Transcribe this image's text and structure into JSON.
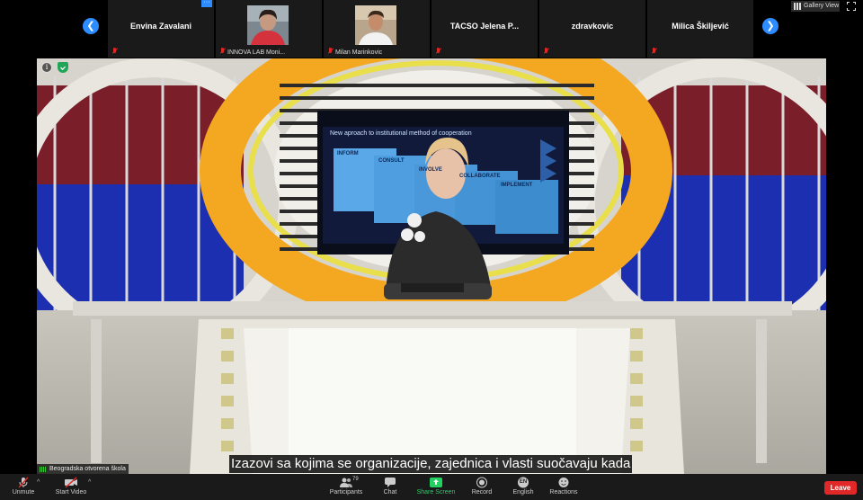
{
  "participants": [
    {
      "name": "Envina Zavalani",
      "has_video": false
    },
    {
      "name": "INNOVA LAB Moni...",
      "has_video": true
    },
    {
      "name": "Milan Marinkovic",
      "has_video": true
    },
    {
      "name": "TACSO Jelena P...",
      "has_video": false
    },
    {
      "name": "zdravkovic",
      "has_video": false
    },
    {
      "name": "Milica Škiljević",
      "has_video": false
    }
  ],
  "more_button": "···",
  "gallery_view_label": "Gallery View",
  "video": {
    "speaker_name": "Beogradska otvorena škola",
    "caption": "Izazovi sa kojima se organizacije, zajednica i vlasti suočavaju kada",
    "slide_title": "New aproach to institutional method of cooperation",
    "slide_steps": [
      "INFORM",
      "CONSULT",
      "INVOLVE",
      "COLLABORATE",
      "IMPLEMENT"
    ]
  },
  "toolbar": {
    "unmute": "Unmute",
    "start_video": "Start Video",
    "participants": "Participants",
    "participants_count": "79",
    "chat": "Chat",
    "share_screen": "Share Screen",
    "record": "Record",
    "language": "English",
    "language_code": "EN",
    "reactions": "Reactions",
    "leave": "Leave"
  },
  "colors": {
    "accent_blue": "#2d8cff",
    "share_green": "#23d160",
    "leave_red": "#e02828",
    "stage_yellow": "#f4a821"
  }
}
